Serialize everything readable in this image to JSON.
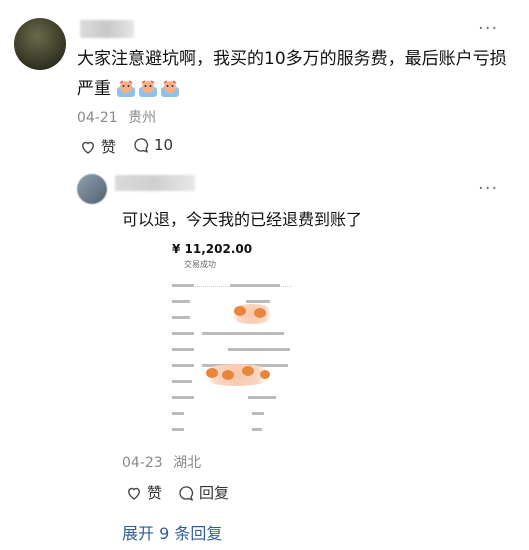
{
  "comment": {
    "text": "大家注意避坑啊，我买的10多万的服务费，最后账户亏损严重",
    "emoji_count": 3,
    "date": "04-21",
    "location": "贵州",
    "like_label": "赞",
    "reply_count": "10"
  },
  "reply": {
    "text": "可以退，今天我的已经退费到账了",
    "receipt": {
      "amount": "¥ 11,202.00",
      "status": "交易成功"
    },
    "date": "04-23",
    "location": "湖北",
    "like_label": "赞",
    "reply_label": "回复"
  },
  "expand_label": "展开 9 条回复",
  "more_icon": "ellipsis-icon",
  "colors": {
    "link": "#335c9c",
    "meta": "#8a8a8a"
  }
}
